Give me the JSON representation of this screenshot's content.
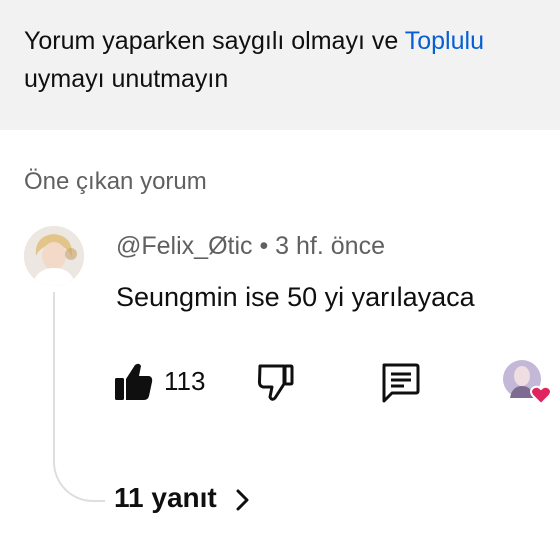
{
  "notice": {
    "text_part1": "Yorum yaparken saygılı olmayı ve ",
    "link_text": "Toplulu",
    "text_line2": "uymayı unutmayın"
  },
  "featured": {
    "label": "Öne çıkan yorum"
  },
  "comment": {
    "author": "@Felix_Øtic",
    "separator": " • ",
    "time": "3 hf. önce",
    "text": "Seungmin ise 50 yi yarılayaca",
    "likes": "113",
    "replies_label": "11 yanıt"
  },
  "icons": {
    "avatar": "user-avatar",
    "like": "thumb-up-icon",
    "dislike": "thumb-down-icon",
    "reply": "comment-icon",
    "creator_heart": "creator-heart-icon",
    "chevron": "chevron-right-icon"
  },
  "colors": {
    "link": "#065fd4",
    "secondary_text": "#606060",
    "heart": "#e0245e",
    "notice_bg": "#f2f2f2"
  }
}
